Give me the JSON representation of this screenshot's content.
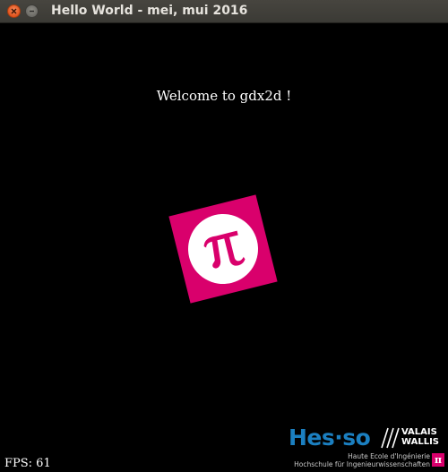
{
  "window": {
    "title": "Hello World - mei, mui 2016"
  },
  "content": {
    "welcome_text": "Welcome to gdx2d !",
    "fps_label": "FPS: 61",
    "pi_symbol": "π"
  },
  "branding": {
    "hes_text": "Hes·so",
    "region_line1": "VALAIS",
    "region_line2": "WALLIS",
    "subtitle_fr": "Haute Ecole d'Ingénierie",
    "subtitle_de": "Hochschule für Ingenieurwissenschaften",
    "pi_badge": "π"
  },
  "colors": {
    "accent_magenta": "#d9006c",
    "hes_blue": "#1b7fc0",
    "close_orange": "#e2531c"
  }
}
